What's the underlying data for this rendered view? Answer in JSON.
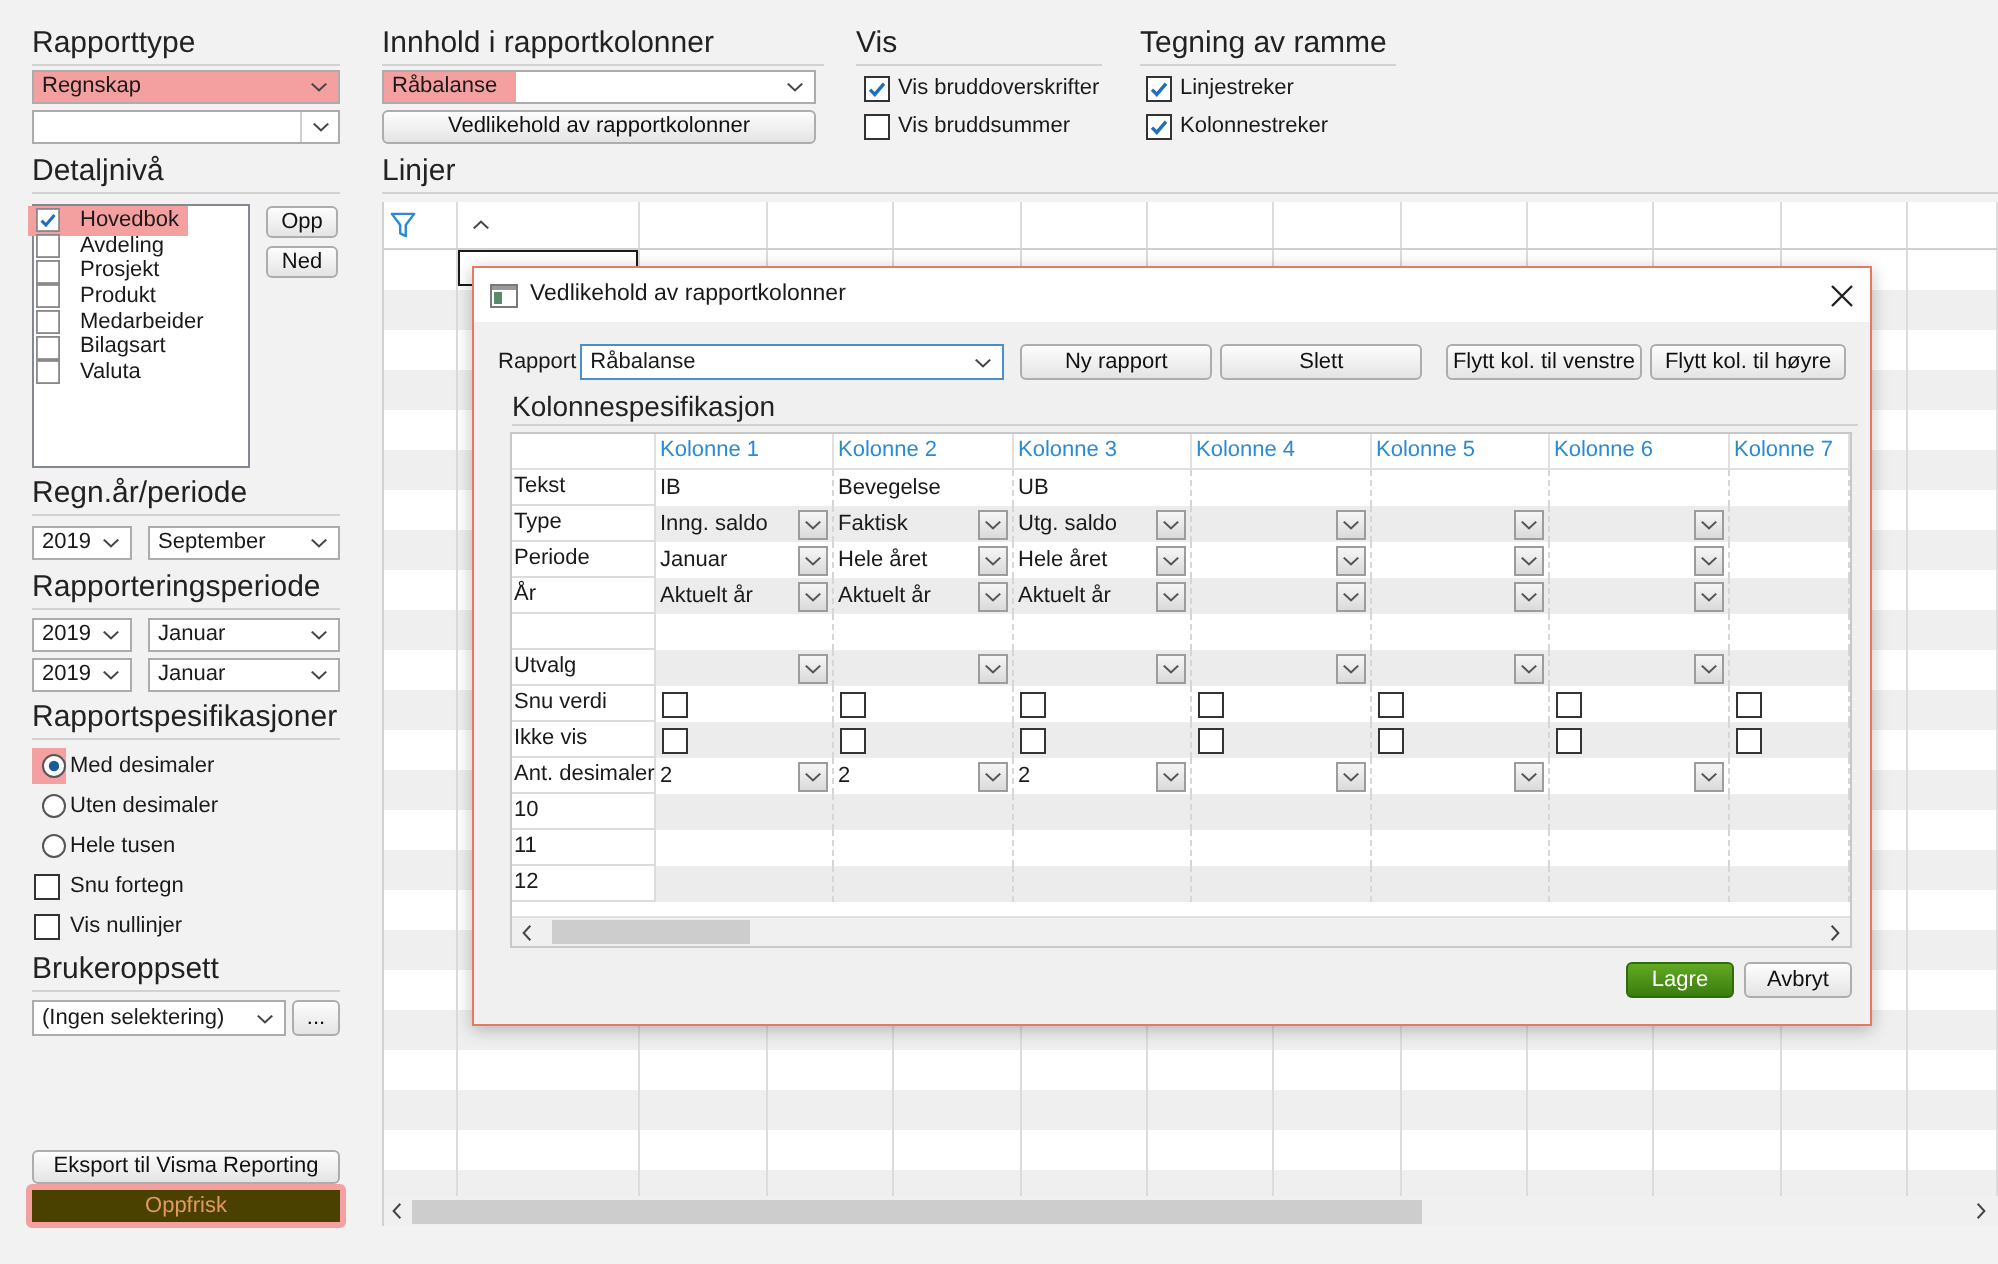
{
  "report_type": {
    "heading": "Rapporttype",
    "value": "Regnskap",
    "highlighted": true
  },
  "detail_level": {
    "heading": "Detaljnivå",
    "items": [
      {
        "label": "Hovedbok",
        "checked": true,
        "highlighted": true
      },
      {
        "label": "Avdeling",
        "checked": false,
        "highlighted": false
      },
      {
        "label": "Prosjekt",
        "checked": false,
        "highlighted": false
      },
      {
        "label": "Produkt",
        "checked": false,
        "highlighted": false
      },
      {
        "label": "Medarbeider",
        "checked": false,
        "highlighted": false
      },
      {
        "label": "Bilagsart",
        "checked": false,
        "highlighted": false
      },
      {
        "label": "Valuta",
        "checked": false,
        "highlighted": false
      }
    ],
    "buttons": [
      "Opp",
      "Ned"
    ]
  },
  "accounting_period": {
    "heading": "Regn.år/periode",
    "year": "2019",
    "period": "September"
  },
  "reporting_period": {
    "heading": "Rapporteringsperiode",
    "ranges": [
      {
        "year": "2019",
        "period": "Januar"
      },
      {
        "year": "2019",
        "period": "Januar"
      }
    ]
  },
  "report_specifications": {
    "heading": "Rapportspesifikasjoner",
    "options": [
      {
        "kind": "radio",
        "label": "Med desimaler",
        "selected": true,
        "highlighted": true
      },
      {
        "kind": "radio",
        "label": "Uten desimaler",
        "selected": false,
        "highlighted": false
      },
      {
        "kind": "radio",
        "label": "Hele tusen",
        "selected": false,
        "highlighted": false
      },
      {
        "kind": "checkbox",
        "label": "Snu fortegn",
        "checked": false,
        "highlighted": false
      },
      {
        "kind": "checkbox",
        "label": "Vis nullinjer",
        "checked": false,
        "highlighted": false
      }
    ]
  },
  "user_setup": {
    "heading": "Brukeroppsett",
    "value": "(Ingen selektering)",
    "more_button": "..."
  },
  "export_button": "Eksport til Visma Reporting",
  "refresh_button": {
    "label": "Oppfrisk",
    "highlighted": true
  },
  "column_content": {
    "heading": "Innhold i rapportkolonner",
    "value": "Råbalanse",
    "highlighted": true,
    "button": "Vedlikehold av rapportkolonner"
  },
  "show": {
    "heading": "Vis",
    "options": [
      {
        "label": "Vis bruddoverskrifter",
        "checked": true
      },
      {
        "label": "Vis bruddsummer",
        "checked": false
      }
    ]
  },
  "frame_drawing": {
    "heading": "Tegning av ramme",
    "options": [
      {
        "label": "Linjestreker",
        "checked": true
      },
      {
        "label": "Kolonnestreker",
        "checked": true
      }
    ]
  },
  "lines": {
    "heading": "Linjer"
  },
  "dialog": {
    "title": "Vedlikehold av rapportkolonner",
    "report": {
      "label": "Rapport",
      "value": "Råbalanse"
    },
    "buttons": [
      "Ny rapport",
      "Slett"
    ],
    "move_buttons": [
      "Flytt kol. til venstre",
      "Flytt kol. til høyre"
    ],
    "section_heading": "Kolonnespesifikasjon",
    "table": {
      "columns": [
        "Kolonne 1",
        "Kolonne 2",
        "Kolonne 3",
        "Kolonne 4",
        "Kolonne 5",
        "Kolonne 6",
        "Kolonne 7"
      ],
      "rows": [
        {
          "label": "Tekst",
          "kind": "text",
          "cells": [
            "IB",
            "Bevegelse",
            "UB"
          ]
        },
        {
          "label": "Type",
          "kind": "dropdown",
          "cells": [
            "Inng. saldo",
            "Faktisk",
            "Utg. saldo"
          ]
        },
        {
          "label": "Periode",
          "kind": "dropdown",
          "cells": [
            "Januar",
            "Hele året",
            "Hele året"
          ]
        },
        {
          "label": "År",
          "kind": "dropdown",
          "cells": [
            "Aktuelt år",
            "Aktuelt år",
            "Aktuelt år"
          ]
        },
        {
          "kind": "text"
        },
        {
          "label": "Utvalg",
          "kind": "dropdown"
        },
        {
          "label": "Snu verdi",
          "kind": "checkbox",
          "checked": [
            false,
            false,
            false,
            false,
            false,
            false,
            false
          ]
        },
        {
          "label": "Ikke vis",
          "kind": "checkbox",
          "checked": [
            false,
            false,
            false,
            false,
            false,
            false,
            false
          ]
        },
        {
          "label": "Ant. desimaler",
          "kind": "dropdown",
          "cells": [
            "2",
            "2",
            "2"
          ]
        },
        {
          "label": "10",
          "kind": "text"
        },
        {
          "label": "11",
          "kind": "text"
        },
        {
          "label": "12",
          "kind": "text"
        }
      ]
    },
    "footer_buttons": [
      {
        "label": "Lagre",
        "kind": "primary"
      },
      {
        "label": "Avbryt",
        "kind": "default"
      }
    ]
  }
}
